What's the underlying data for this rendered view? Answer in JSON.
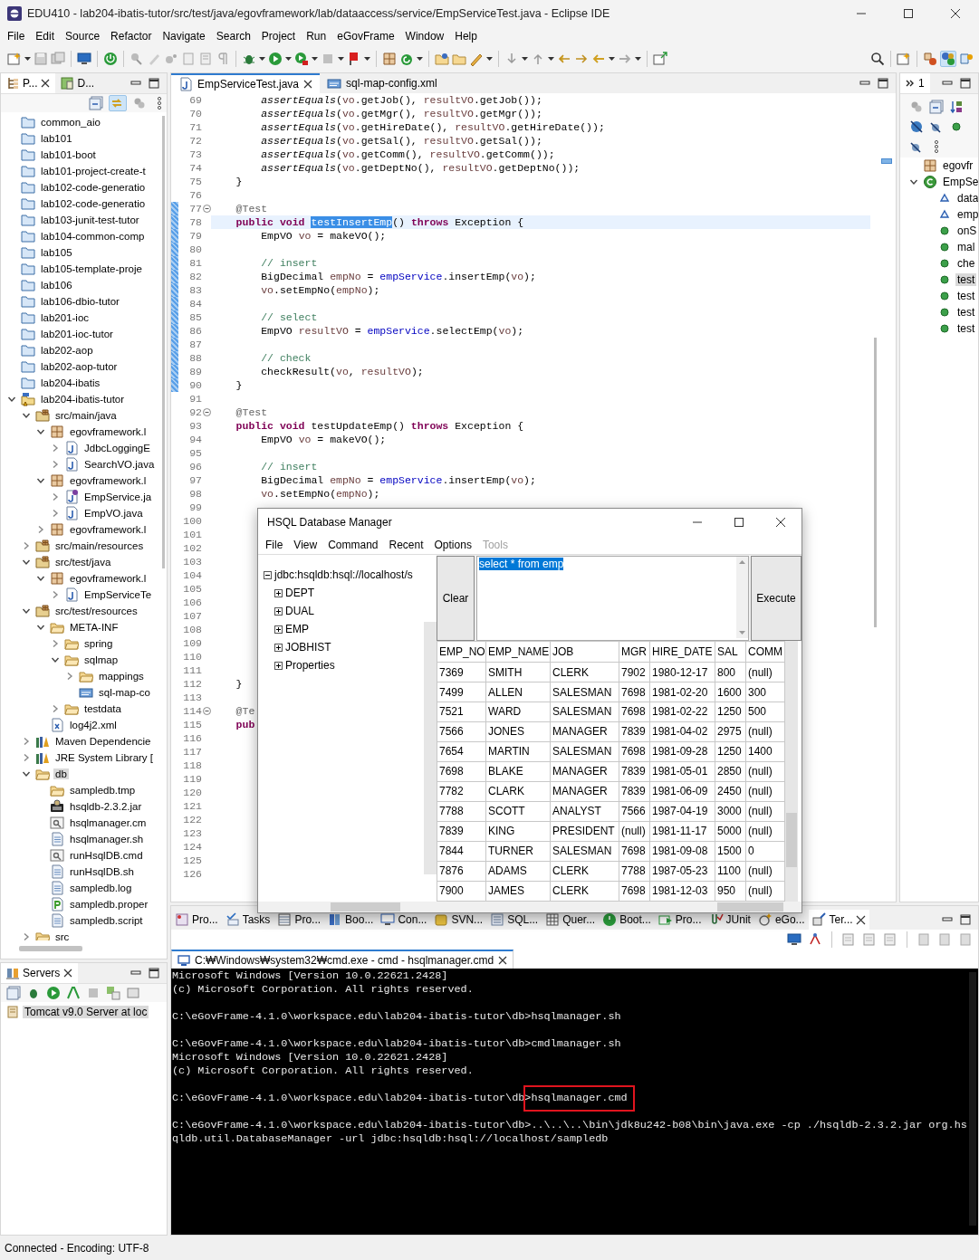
{
  "window": {
    "title": "EDU410 - lab204-ibatis-tutor/src/test/java/egovframework/lab/dataaccess/service/EmpServiceTest.java - Eclipse IDE"
  },
  "menu": [
    "File",
    "Edit",
    "Source",
    "Refactor",
    "Navigate",
    "Search",
    "Project",
    "Run",
    "eGovFrame",
    "Window",
    "Help"
  ],
  "explorer": {
    "tabs": [
      {
        "label": "P...",
        "selected": true
      },
      {
        "label": "D...",
        "selected": false
      }
    ],
    "items": [
      {
        "label": "common_aio",
        "kind": "project",
        "selected": false
      },
      {
        "label": "lab101",
        "kind": "project",
        "selected": false
      },
      {
        "label": "lab101-boot",
        "kind": "project",
        "selected": false
      },
      {
        "label": "lab101-project-create-t",
        "kind": "project",
        "selected": false
      },
      {
        "label": "lab102-code-generatio",
        "kind": "project",
        "selected": false
      },
      {
        "label": "lab102-code-generatio",
        "kind": "project",
        "selected": false
      },
      {
        "label": "lab103-junit-test-tutor",
        "kind": "project",
        "selected": false
      },
      {
        "label": "lab104-common-comp",
        "kind": "project",
        "selected": false
      },
      {
        "label": "lab105",
        "kind": "project",
        "selected": false
      },
      {
        "label": "lab105-template-proje",
        "kind": "project",
        "selected": false
      },
      {
        "label": "lab106",
        "kind": "project",
        "selected": false
      },
      {
        "label": "lab106-dbio-tutor",
        "kind": "project",
        "selected": false
      },
      {
        "label": "lab201-ioc",
        "kind": "project",
        "selected": false
      },
      {
        "label": "lab201-ioc-tutor",
        "kind": "project",
        "selected": false
      },
      {
        "label": "lab202-aop",
        "kind": "project",
        "selected": false
      },
      {
        "label": "lab202-aop-tutor",
        "kind": "project",
        "selected": false
      },
      {
        "label": "lab204-ibatis",
        "kind": "project",
        "selected": false
      },
      {
        "label": "lab204-ibatis-tutor",
        "kind": "maven-project",
        "selected": false,
        "expanded": true,
        "children": [
          {
            "label": "src/main/java",
            "kind": "src-folder",
            "selected": false,
            "expanded": true,
            "children": [
              {
                "label": "egovframework.l",
                "kind": "package",
                "selected": false,
                "expanded": true,
                "children": [
                  {
                    "label": "JdbcLoggingE",
                    "kind": "java",
                    "selected": false,
                    "expanded": false
                  },
                  {
                    "label": "SearchVO.java",
                    "kind": "java",
                    "selected": false,
                    "expanded": false
                  }
                ]
              },
              {
                "label": "egovframework.l",
                "kind": "package",
                "selected": false,
                "expanded": true,
                "children": [
                  {
                    "label": "EmpService.ja",
                    "kind": "interface",
                    "selected": false,
                    "expanded": false
                  },
                  {
                    "label": "EmpVO.java",
                    "kind": "java",
                    "selected": false,
                    "expanded": false
                  }
                ]
              },
              {
                "label": "egovframework.l",
                "kind": "package",
                "selected": false,
                "expanded": false
              }
            ]
          },
          {
            "label": "src/main/resources",
            "kind": "src-folder",
            "selected": false,
            "expanded": false
          },
          {
            "label": "src/test/java",
            "kind": "src-folder",
            "selected": false,
            "expanded": true,
            "children": [
              {
                "label": "egovframework.l",
                "kind": "package",
                "selected": false,
                "expanded": true,
                "children": [
                  {
                    "label": "EmpServiceTe",
                    "kind": "java",
                    "selected": false,
                    "expanded": false
                  }
                ]
              }
            ]
          },
          {
            "label": "src/test/resources",
            "kind": "src-folder",
            "selected": false,
            "expanded": true,
            "children": [
              {
                "label": "META-INF",
                "kind": "folder",
                "selected": false,
                "expanded": true,
                "children": [
                  {
                    "label": "spring",
                    "kind": "folder",
                    "selected": false,
                    "expanded": false
                  },
                  {
                    "label": "sqlmap",
                    "kind": "folder",
                    "selected": false,
                    "expanded": true,
                    "children": [
                      {
                        "label": "mappings",
                        "kind": "folder",
                        "selected": false,
                        "expanded": false
                      },
                      {
                        "label": "sql-map-co",
                        "kind": "cfg",
                        "selected": false
                      }
                    ]
                  },
                  {
                    "label": "testdata",
                    "kind": "folder",
                    "selected": false,
                    "expanded": false
                  }
                ]
              },
              {
                "label": "log4j2.xml",
                "kind": "xml",
                "selected": false
              }
            ]
          },
          {
            "label": "Maven Dependencie",
            "kind": "library",
            "selected": false,
            "expanded": false
          },
          {
            "label": "JRE System Library [",
            "kind": "library",
            "selected": false,
            "expanded": false
          },
          {
            "label": "db",
            "kind": "folder",
            "selected": true,
            "expanded": true,
            "children": [
              {
                "label": "sampledb.tmp",
                "kind": "folder",
                "selected": false
              },
              {
                "label": "hsqldb-2.3.2.jar",
                "kind": "jar",
                "selected": false
              },
              {
                "label": "hsqlmanager.cm",
                "kind": "cmd",
                "selected": false
              },
              {
                "label": "hsqlmanager.sh",
                "kind": "text",
                "selected": false
              },
              {
                "label": "runHsqlDB.cmd",
                "kind": "cmd",
                "selected": false
              },
              {
                "label": "runHsqlDB.sh",
                "kind": "text",
                "selected": false
              },
              {
                "label": "sampledb.log",
                "kind": "text",
                "selected": false
              },
              {
                "label": "sampledb.proper",
                "kind": "props",
                "selected": false
              },
              {
                "label": "sampledb.script",
                "kind": "text",
                "selected": false
              }
            ]
          },
          {
            "label": "src",
            "kind": "folder",
            "selected": false,
            "expanded": false
          }
        ]
      }
    ]
  },
  "servers": {
    "tab": {
      "label": "Servers",
      "selected": true
    },
    "items": [
      {
        "label": "Tomcat v9.0 Server at loc",
        "selected": true
      }
    ]
  },
  "editor": {
    "tabs": [
      {
        "label": "EmpServiceTest.java",
        "kind": "java",
        "selected": true
      },
      {
        "label": "sql-map-config.xml",
        "kind": "cfg",
        "selected": false
      }
    ],
    "lines": [
      {
        "n": "69",
        "changed": false,
        "current": false,
        "fold": false,
        "code": [
          {
            "text": "        assertEquals",
            "kind": "static"
          },
          {
            "text": "(",
            "kind": "plain"
          },
          {
            "text": "vo",
            "kind": "local"
          },
          {
            "text": ".getJob(), ",
            "kind": "plain"
          },
          {
            "text": "resultVO",
            "kind": "local"
          },
          {
            "text": ".getJob());",
            "kind": "plain"
          }
        ]
      },
      {
        "n": "70",
        "changed": false,
        "current": false,
        "fold": false,
        "code": [
          {
            "text": "        assertEquals",
            "kind": "static"
          },
          {
            "text": "(",
            "kind": "plain"
          },
          {
            "text": "vo",
            "kind": "local"
          },
          {
            "text": ".getMgr(), ",
            "kind": "plain"
          },
          {
            "text": "resultVO",
            "kind": "local"
          },
          {
            "text": ".getMgr());",
            "kind": "plain"
          }
        ]
      },
      {
        "n": "71",
        "changed": false,
        "current": false,
        "fold": false,
        "code": [
          {
            "text": "        assertEquals",
            "kind": "static"
          },
          {
            "text": "(",
            "kind": "plain"
          },
          {
            "text": "vo",
            "kind": "local"
          },
          {
            "text": ".getHireDate(), ",
            "kind": "plain"
          },
          {
            "text": "resultVO",
            "kind": "local"
          },
          {
            "text": ".getHireDate());",
            "kind": "plain"
          }
        ]
      },
      {
        "n": "72",
        "changed": false,
        "current": false,
        "fold": false,
        "code": [
          {
            "text": "        assertEquals",
            "kind": "static"
          },
          {
            "text": "(",
            "kind": "plain"
          },
          {
            "text": "vo",
            "kind": "local"
          },
          {
            "text": ".getSal(), ",
            "kind": "plain"
          },
          {
            "text": "resultVO",
            "kind": "local"
          },
          {
            "text": ".getSal());",
            "kind": "plain"
          }
        ]
      },
      {
        "n": "73",
        "changed": false,
        "current": false,
        "fold": false,
        "code": [
          {
            "text": "        assertEquals",
            "kind": "static"
          },
          {
            "text": "(",
            "kind": "plain"
          },
          {
            "text": "vo",
            "kind": "local"
          },
          {
            "text": ".getComm(), ",
            "kind": "plain"
          },
          {
            "text": "resultVO",
            "kind": "local"
          },
          {
            "text": ".getComm());",
            "kind": "plain"
          }
        ]
      },
      {
        "n": "74",
        "changed": false,
        "current": false,
        "fold": false,
        "code": [
          {
            "text": "        assertEquals",
            "kind": "static"
          },
          {
            "text": "(",
            "kind": "plain"
          },
          {
            "text": "vo",
            "kind": "local"
          },
          {
            "text": ".getDeptNo(), ",
            "kind": "plain"
          },
          {
            "text": "resultVO",
            "kind": "local"
          },
          {
            "text": ".getDeptNo());",
            "kind": "plain"
          }
        ]
      },
      {
        "n": "75",
        "changed": false,
        "current": false,
        "fold": false,
        "code": [
          {
            "text": "    }",
            "kind": "plain"
          }
        ]
      },
      {
        "n": "76",
        "changed": false,
        "current": false,
        "fold": false
      },
      {
        "n": "77",
        "changed": true,
        "current": false,
        "fold": true,
        "code": [
          {
            "text": "    @Test",
            "kind": "annotation"
          }
        ]
      },
      {
        "n": "78",
        "changed": true,
        "current": true,
        "fold": false,
        "code": [
          {
            "text": "    public",
            "kind": "keyword"
          },
          {
            "text": " void ",
            "kind": "keyword"
          },
          {
            "text": "testInsertEmp",
            "kind": "selection"
          },
          {
            "text": "() ",
            "kind": "plain"
          },
          {
            "text": "throws",
            "kind": "keyword"
          },
          {
            "text": " Exception {",
            "kind": "plain"
          }
        ]
      },
      {
        "n": "79",
        "changed": true,
        "current": false,
        "fold": false,
        "code": [
          {
            "text": "        EmpVO ",
            "kind": "plain"
          },
          {
            "text": "vo",
            "kind": "local"
          },
          {
            "text": " = makeVO();",
            "kind": "plain"
          }
        ]
      },
      {
        "n": "80",
        "changed": true,
        "current": false,
        "fold": false
      },
      {
        "n": "81",
        "changed": true,
        "current": false,
        "fold": false,
        "code": [
          {
            "text": "        // insert",
            "kind": "comment"
          }
        ]
      },
      {
        "n": "82",
        "changed": true,
        "current": false,
        "fold": false,
        "code": [
          {
            "text": "        BigDecimal ",
            "kind": "plain"
          },
          {
            "text": "empNo",
            "kind": "local"
          },
          {
            "text": " = ",
            "kind": "plain"
          },
          {
            "text": "empService",
            "kind": "field"
          },
          {
            "text": ".insertEmp(",
            "kind": "plain"
          },
          {
            "text": "vo",
            "kind": "local"
          },
          {
            "text": ");",
            "kind": "plain"
          }
        ]
      },
      {
        "n": "83",
        "changed": true,
        "current": false,
        "fold": false,
        "code": [
          {
            "text": "        vo",
            "kind": "local"
          },
          {
            "text": ".setEmpNo(",
            "kind": "plain"
          },
          {
            "text": "empNo",
            "kind": "local"
          },
          {
            "text": ");",
            "kind": "plain"
          }
        ]
      },
      {
        "n": "84",
        "changed": true,
        "current": false,
        "fold": false
      },
      {
        "n": "85",
        "changed": true,
        "current": false,
        "fold": false,
        "code": [
          {
            "text": "        // select",
            "kind": "comment"
          }
        ]
      },
      {
        "n": "86",
        "changed": true,
        "current": false,
        "fold": false,
        "code": [
          {
            "text": "        EmpVO ",
            "kind": "plain"
          },
          {
            "text": "resultVO",
            "kind": "local"
          },
          {
            "text": " = ",
            "kind": "plain"
          },
          {
            "text": "empService",
            "kind": "field"
          },
          {
            "text": ".selectEmp(",
            "kind": "plain"
          },
          {
            "text": "vo",
            "kind": "local"
          },
          {
            "text": ");",
            "kind": "plain"
          }
        ]
      },
      {
        "n": "87",
        "changed": true,
        "current": false,
        "fold": false
      },
      {
        "n": "88",
        "changed": true,
        "current": false,
        "fold": false,
        "code": [
          {
            "text": "        // check",
            "kind": "comment"
          }
        ]
      },
      {
        "n": "89",
        "changed": true,
        "current": false,
        "fold": false,
        "code": [
          {
            "text": "        checkResult(",
            "kind": "plain"
          },
          {
            "text": "vo",
            "kind": "local"
          },
          {
            "text": ", ",
            "kind": "plain"
          },
          {
            "text": "resultVO",
            "kind": "local"
          },
          {
            "text": ");",
            "kind": "plain"
          }
        ]
      },
      {
        "n": "90",
        "changed": true,
        "current": false,
        "fold": false,
        "code": [
          {
            "text": "    }",
            "kind": "plain"
          }
        ]
      },
      {
        "n": "91",
        "changed": false,
        "current": false,
        "fold": false
      },
      {
        "n": "92",
        "changed": false,
        "current": false,
        "fold": true,
        "code": [
          {
            "text": "    @Test",
            "kind": "annotation"
          }
        ]
      },
      {
        "n": "93",
        "changed": false,
        "current": false,
        "fold": false,
        "code": [
          {
            "text": "    public",
            "kind": "keyword"
          },
          {
            "text": " void",
            "kind": "keyword"
          },
          {
            "text": " testUpdateEmp() ",
            "kind": "plain"
          },
          {
            "text": "throws",
            "kind": "keyword"
          },
          {
            "text": " Exception {",
            "kind": "plain"
          }
        ]
      },
      {
        "n": "94",
        "changed": false,
        "current": false,
        "fold": false,
        "code": [
          {
            "text": "        EmpVO ",
            "kind": "plain"
          },
          {
            "text": "vo",
            "kind": "local"
          },
          {
            "text": " = makeVO();",
            "kind": "plain"
          }
        ]
      },
      {
        "n": "95",
        "changed": false,
        "current": false,
        "fold": false
      },
      {
        "n": "96",
        "changed": false,
        "current": false,
        "fold": false,
        "code": [
          {
            "text": "        // insert",
            "kind": "comment"
          }
        ]
      },
      {
        "n": "97",
        "changed": false,
        "current": false,
        "fold": false,
        "code": [
          {
            "text": "        BigDecimal ",
            "kind": "plain"
          },
          {
            "text": "empNo",
            "kind": "local"
          },
          {
            "text": " = ",
            "kind": "plain"
          },
          {
            "text": "empService",
            "kind": "field"
          },
          {
            "text": ".insertEmp(",
            "kind": "plain"
          },
          {
            "text": "vo",
            "kind": "local"
          },
          {
            "text": ");",
            "kind": "plain"
          }
        ]
      },
      {
        "n": "98",
        "changed": false,
        "current": false,
        "fold": false,
        "code": [
          {
            "text": "        vo",
            "kind": "local"
          },
          {
            "text": ".setEmpNo(",
            "kind": "plain"
          },
          {
            "text": "empNo",
            "kind": "local"
          },
          {
            "text": ");",
            "kind": "plain"
          }
        ]
      },
      {
        "n": "99",
        "changed": false,
        "current": false,
        "fold": false
      },
      {
        "n": "100",
        "changed": false,
        "current": false,
        "fold": false
      },
      {
        "n": "101",
        "changed": false,
        "current": false,
        "fold": false
      },
      {
        "n": "102",
        "changed": false,
        "current": false,
        "fold": false
      },
      {
        "n": "103",
        "changed": false,
        "current": false,
        "fold": false
      },
      {
        "n": "104",
        "changed": false,
        "current": false,
        "fold": false
      },
      {
        "n": "105",
        "changed": false,
        "current": false,
        "fold": false
      },
      {
        "n": "106",
        "changed": false,
        "current": false,
        "fold": false
      },
      {
        "n": "107",
        "changed": false,
        "current": false,
        "fold": false
      },
      {
        "n": "108",
        "changed": false,
        "current": false,
        "fold": false
      },
      {
        "n": "109",
        "changed": false,
        "current": false,
        "fold": false
      },
      {
        "n": "110",
        "changed": false,
        "current": false,
        "fold": false
      },
      {
        "n": "111",
        "changed": false,
        "current": false,
        "fold": false
      },
      {
        "n": "112",
        "changed": false,
        "current": false,
        "fold": false,
        "code": [
          {
            "text": "    }",
            "kind": "plain"
          }
        ]
      },
      {
        "n": "113",
        "changed": false,
        "current": false,
        "fold": false
      },
      {
        "n": "114",
        "changed": false,
        "current": false,
        "fold": true,
        "code": [
          {
            "text": "    @Te",
            "kind": "annotation"
          }
        ]
      },
      {
        "n": "115",
        "changed": false,
        "current": false,
        "fold": false,
        "code": [
          {
            "text": "    pub",
            "kind": "keyword"
          }
        ]
      },
      {
        "n": "116",
        "changed": false,
        "current": false,
        "fold": false
      },
      {
        "n": "117",
        "changed": false,
        "current": false,
        "fold": false
      },
      {
        "n": "118",
        "changed": false,
        "current": false,
        "fold": false
      },
      {
        "n": "119",
        "changed": false,
        "current": false,
        "fold": false
      },
      {
        "n": "120",
        "changed": false,
        "current": false,
        "fold": false
      },
      {
        "n": "121",
        "changed": false,
        "current": false,
        "fold": false
      },
      {
        "n": "122",
        "changed": false,
        "current": false,
        "fold": false
      },
      {
        "n": "123",
        "changed": false,
        "current": false,
        "fold": false
      },
      {
        "n": "124",
        "changed": false,
        "current": false,
        "fold": false
      },
      {
        "n": "125",
        "changed": false,
        "current": false,
        "fold": false
      },
      {
        "n": "126",
        "changed": false,
        "current": false,
        "fold": false
      }
    ]
  },
  "outline": {
    "overflow_count": "1",
    "items": [
      {
        "label": "egovfr",
        "kind": "package",
        "selected": false
      },
      {
        "label": "EmpSe",
        "kind": "class",
        "selected": false,
        "expanded": true,
        "children": [
          {
            "label": "data",
            "kind": "field",
            "selected": false
          },
          {
            "label": "emp",
            "kind": "field",
            "selected": false
          },
          {
            "label": "onS",
            "kind": "method",
            "selected": false
          },
          {
            "label": "mal",
            "kind": "method",
            "selected": false
          },
          {
            "label": "che",
            "kind": "method",
            "selected": false
          },
          {
            "label": "test",
            "kind": "method",
            "selected": true
          },
          {
            "label": "test",
            "kind": "method",
            "selected": false
          },
          {
            "label": "test",
            "kind": "method",
            "selected": false
          },
          {
            "label": "test",
            "kind": "method",
            "selected": false
          }
        ]
      }
    ]
  },
  "bottom_panel": {
    "tabs": [
      {
        "label": "Pro...",
        "selected": false
      },
      {
        "label": "Tasks",
        "selected": false
      },
      {
        "label": "Pro...",
        "selected": false
      },
      {
        "label": "Boo...",
        "selected": false
      },
      {
        "label": "Con...",
        "selected": false
      },
      {
        "label": "SVN...",
        "selected": false
      },
      {
        "label": "SQL...",
        "selected": false
      },
      {
        "label": "Quer...",
        "selected": false
      },
      {
        "label": "Boot...",
        "selected": false
      },
      {
        "label": "Pro...",
        "selected": false
      },
      {
        "label": "JUnit",
        "selected": false
      },
      {
        "label": "eGo...",
        "selected": false
      },
      {
        "label": "Ter...",
        "selected": true
      }
    ],
    "terminal": {
      "tab": {
        "label": "C:₩Windows₩system32₩cmd.exe - cmd - hsqlmanager.cmd",
        "selected": true
      },
      "blocks": [
        [
          {
            "text": "Microsoft Windows [Version 10.0.22621.2428]"
          },
          {
            "text": "(c) Microsoft Corporation. All rights reserved."
          }
        ],
        [
          {
            "text": "C:\\eGovFrame-4.1.0\\workspace.edu\\lab204-ibatis-tutor\\db>hsqlmanager.sh"
          }
        ],
        [
          {
            "text": "C:\\eGovFrame-4.1.0\\workspace.edu\\lab204-ibatis-tutor\\db>cmdlmanager.sh"
          },
          {
            "text": "Microsoft Windows [Version 10.0.22621.2428]"
          },
          {
            "text": "(c) Microsoft Corporation. All rights reserved."
          }
        ],
        [
          {
            "parts": [
              {
                "text": "C:\\eGovFrame-4.1.0\\workspace.edu\\lab204-ibatis-tutor\\db>",
                "marked": false
              },
              {
                "text": "hsqlmanager.cmd",
                "marked": true
              }
            ]
          }
        ],
        [
          {
            "text": "C:\\eGovFrame-4.1.0\\workspace.edu\\lab204-ibatis-tutor\\db>..\\..\\..\\bin\\jdk8u242-b08\\bin\\java.exe -cp ./hsqldb-2.3.2.jar org.hs"
          },
          {
            "text": "qldb.util.DatabaseManager -url jdbc:hsqldb:hsql://localhost/sampledb"
          }
        ]
      ]
    }
  },
  "hsql": {
    "title": "HSQL Database Manager",
    "menu": [
      {
        "label": "File",
        "disabled": false
      },
      {
        "label": "View",
        "disabled": false
      },
      {
        "label": "Command",
        "disabled": false
      },
      {
        "label": "Recent",
        "disabled": false
      },
      {
        "label": "Options",
        "disabled": false
      },
      {
        "label": "Tools",
        "disabled": true
      }
    ],
    "tree": {
      "label": "jdbc:hsqldb:hsql://localhost/s",
      "expanded": true,
      "children": [
        {
          "label": "DEPT",
          "expanded": false
        },
        {
          "label": "DUAL",
          "expanded": false
        },
        {
          "label": "EMP",
          "expanded": false
        },
        {
          "label": "JOBHIST",
          "expanded": false
        },
        {
          "label": "Properties",
          "expanded": false
        }
      ]
    },
    "buttons": [
      "Clear",
      "Execute"
    ],
    "query": {
      "text": "select * from emp",
      "selected": true
    },
    "table": {
      "columns": [
        "EMP_NO",
        "EMP_NAME",
        "JOB",
        "MGR",
        "HIRE_DATE",
        "SAL",
        "COMM"
      ],
      "rows": [
        [
          "7369",
          "SMITH",
          "CLERK",
          "7902",
          "1980-12-17",
          "800",
          "(null)"
        ],
        [
          "7499",
          "ALLEN",
          "SALESMAN",
          "7698",
          "1981-02-20",
          "1600",
          "300"
        ],
        [
          "7521",
          "WARD",
          "SALESMAN",
          "7698",
          "1981-02-22",
          "1250",
          "500"
        ],
        [
          "7566",
          "JONES",
          "MANAGER",
          "7839",
          "1981-04-02",
          "2975",
          "(null)"
        ],
        [
          "7654",
          "MARTIN",
          "SALESMAN",
          "7698",
          "1981-09-28",
          "1250",
          "1400"
        ],
        [
          "7698",
          "BLAKE",
          "MANAGER",
          "7839",
          "1981-05-01",
          "2850",
          "(null)"
        ],
        [
          "7782",
          "CLARK",
          "MANAGER",
          "7839",
          "1981-06-09",
          "2450",
          "(null)"
        ],
        [
          "7788",
          "SCOTT",
          "ANALYST",
          "7566",
          "1987-04-19",
          "3000",
          "(null)"
        ],
        [
          "7839",
          "KING",
          "PRESIDENT",
          "(null)",
          "1981-11-17",
          "5000",
          "(null)"
        ],
        [
          "7844",
          "TURNER",
          "SALESMAN",
          "7698",
          "1981-09-08",
          "1500",
          "0"
        ],
        [
          "7876",
          "ADAMS",
          "CLERK",
          "7788",
          "1987-05-23",
          "1100",
          "(null)"
        ],
        [
          "7900",
          "JAMES",
          "CLERK",
          "7698",
          "1981-12-03",
          "950",
          "(null)"
        ]
      ]
    }
  },
  "status_bar": "Connected - Encoding: UTF-8"
}
